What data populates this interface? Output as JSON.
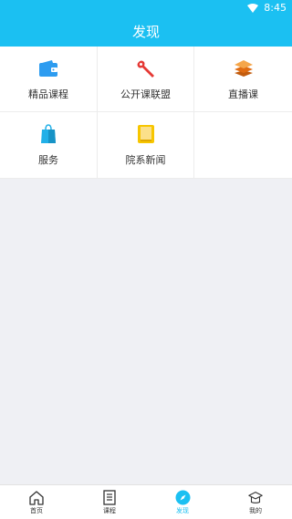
{
  "status": {
    "time": "8:45"
  },
  "header": {
    "title": "发现"
  },
  "grid": [
    {
      "label": "精品课程",
      "icon": "wallet-icon",
      "color": "#2d9cf0"
    },
    {
      "label": "公开课联盟",
      "icon": "wrench-icon",
      "color": "#e53935"
    },
    {
      "label": "直播课",
      "icon": "layers-icon",
      "color": "#f07c1a"
    },
    {
      "label": "服务",
      "icon": "shopping-bag-icon",
      "color": "#22b0e8"
    },
    {
      "label": "院系新闻",
      "icon": "book-icon",
      "color": "#f7c600"
    }
  ],
  "nav": [
    {
      "label": "首页",
      "icon": "home-icon",
      "active": false
    },
    {
      "label": "课程",
      "icon": "document-icon",
      "active": false
    },
    {
      "label": "发现",
      "icon": "compass-icon",
      "active": true
    },
    {
      "label": "我的",
      "icon": "profile-cap-icon",
      "active": false
    }
  ],
  "colors": {
    "accent": "#1bc0f2",
    "background": "#eff0f4"
  }
}
